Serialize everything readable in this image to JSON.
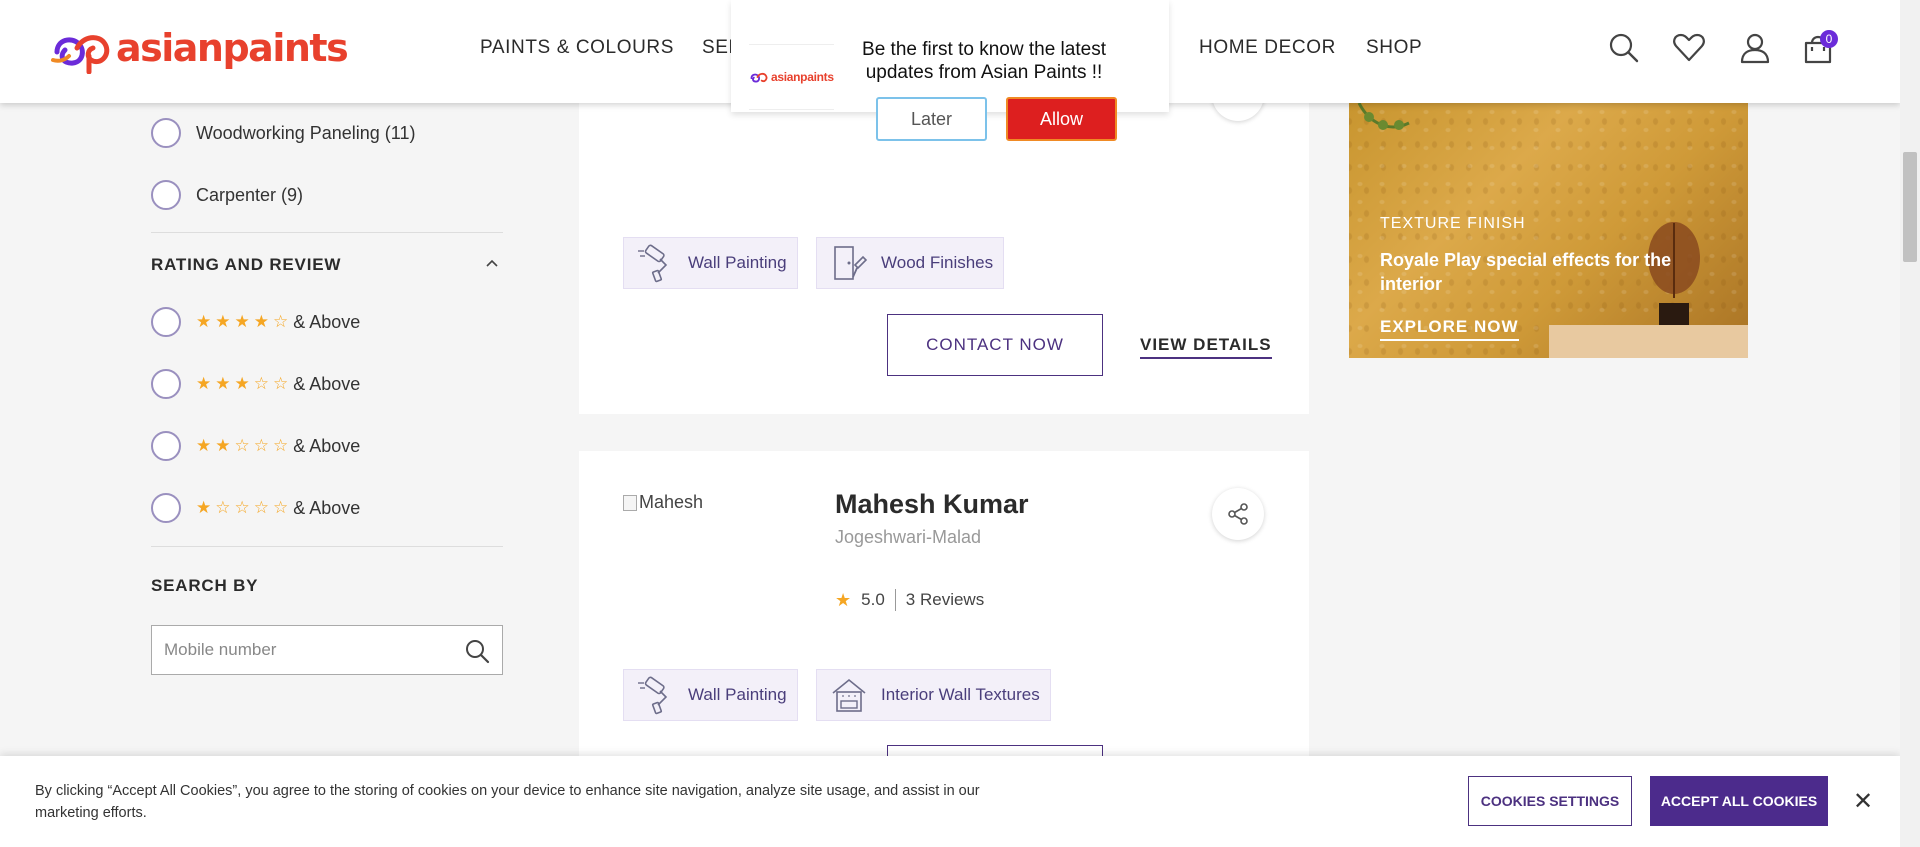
{
  "brand": {
    "name": "asianpaints",
    "accent": "#e8412d",
    "primary": "#4c2b8c"
  },
  "nav": {
    "items": [
      {
        "label": "PAINTS & COLOURS"
      },
      {
        "label": "SER"
      },
      {
        "label": "HOME DECOR"
      },
      {
        "label": "SHOP"
      }
    ]
  },
  "header_icons": {
    "search": "search-icon",
    "wishlist": "heart-icon",
    "account": "user-icon",
    "cart": "cart-icon",
    "cart_count": "0"
  },
  "notification": {
    "brand": "asianpaints",
    "message": "Be the first to know the latest updates from Asian Paints !!",
    "later_label": "Later",
    "allow_label": "Allow"
  },
  "filters": {
    "service_options": [
      {
        "label": "Woodworking Paneling (11)"
      },
      {
        "label": "Carpenter (9)"
      }
    ],
    "rating_title": "RATING AND REVIEW",
    "rating_options": [
      {
        "stars": "★★★★☆",
        "suffix": "& Above"
      },
      {
        "stars": "★★★☆☆",
        "suffix": "& Above"
      },
      {
        "stars": "★★☆☆☆",
        "suffix": "& Above"
      },
      {
        "stars": "★☆☆☆☆",
        "suffix": "& Above"
      }
    ],
    "search_title": "SEARCH BY",
    "search_placeholder": "Mobile number"
  },
  "cards": [
    {
      "tags": [
        {
          "label": "Wall Painting",
          "icon": "paint-roller-icon"
        },
        {
          "label": "Wood Finishes",
          "icon": "door-brush-icon"
        }
      ],
      "contact_label": "CONTACT NOW",
      "view_label": "VIEW DETAILS"
    },
    {
      "image_alt": "Mahesh",
      "name": "Mahesh Kumar",
      "location": "Jogeshwari-Malad",
      "rating": "5.0",
      "reviews": "3 Reviews",
      "tags": [
        {
          "label": "Wall Painting",
          "icon": "paint-roller-icon"
        },
        {
          "label": "Interior Wall Textures",
          "icon": "house-icon"
        }
      ]
    }
  ],
  "banner": {
    "eyebrow": "TEXTURE FINISH",
    "headline": "Royale Play special effects for the interior",
    "cta": "EXPLORE NOW"
  },
  "cookie": {
    "text": "By clicking “Accept All Cookies”, you agree to the storing of cookies on your device to enhance site navigation, analyze site usage, and assist in our marketing efforts.",
    "settings_label": "COOKIES SETTINGS",
    "accept_label": "ACCEPT ALL COOKIES",
    "close_symbol": "✕"
  }
}
